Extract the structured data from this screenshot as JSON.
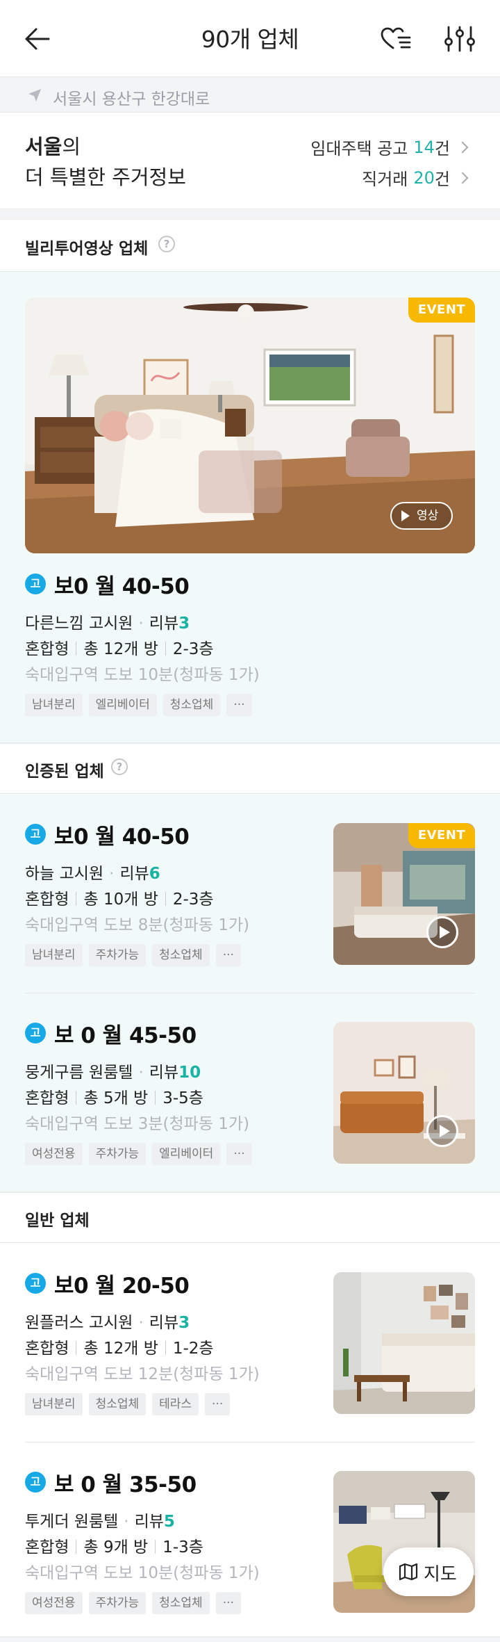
{
  "header": {
    "title": "90개 업체",
    "back_icon": "arrow-left-icon",
    "favorites_icon": "heart-list-icon",
    "filter_icon": "sliders-icon"
  },
  "location": {
    "icon": "navigation-arrow-icon",
    "text": "서울시 용산구 한강대로"
  },
  "summary": {
    "city": "서울",
    "city_suffix": "의",
    "subtitle": "더 특별한 주거정보",
    "rows": [
      {
        "label": "임대주택 공고",
        "count": "14",
        "unit": "건"
      },
      {
        "label": "직거래",
        "count": "20",
        "unit": "건"
      }
    ]
  },
  "sections": {
    "video": {
      "title": "빌리투어영상 업체"
    },
    "verified": {
      "title": "인증된 업체"
    },
    "general": {
      "title": "일반 업체"
    }
  },
  "badges": {
    "event": "EVENT",
    "video_pill": "영상",
    "type_go": "고"
  },
  "colors": {
    "accent_teal": "#18b3a3",
    "badge_blue": "#16a9e6",
    "event_yellow": "#f6b800",
    "mint_bg": "#f1faf9"
  },
  "listings": [
    {
      "price": "보0 월 40-50",
      "name": "다른느낌 고시원",
      "review_label": "리뷰",
      "review_count": "3",
      "room_type": "혼합형",
      "rooms": "총 12개 방",
      "floors": "2-3층",
      "station": "숙대입구역 도보 10분(청파동 1가)",
      "tags": [
        "남녀분리",
        "엘리베이터",
        "청소업체",
        "···"
      ]
    },
    {
      "price": "보0 월 40-50",
      "name": "하늘 고시원",
      "review_label": "리뷰",
      "review_count": "6",
      "room_type": "혼합형",
      "rooms": "총 10개 방",
      "floors": "2-3층",
      "station": "숙대입구역 도보 8분(청파동 1가)",
      "tags": [
        "남녀분리",
        "주차가능",
        "청소업체",
        "···"
      ]
    },
    {
      "price": "보 0 월 45-50",
      "name": "뭉게구름 원룸텔",
      "review_label": "리뷰",
      "review_count": "10",
      "room_type": "혼합형",
      "rooms": "총 5개 방",
      "floors": "3-5층",
      "station": "숙대입구역 도보 3분(청파동 1가)",
      "tags": [
        "여성전용",
        "주차가능",
        "엘리베이터",
        "···"
      ]
    },
    {
      "price": "보0 월 20-50",
      "name": "원플러스 고시원",
      "review_label": "리뷰",
      "review_count": "3",
      "room_type": "혼합형",
      "rooms": "총 12개 방",
      "floors": "1-2층",
      "station": "숙대입구역 도보 12분(청파동 1가)",
      "tags": [
        "남녀분리",
        "청소업체",
        "테라스",
        "···"
      ]
    },
    {
      "price": "보 0 월 35-50",
      "name": "투게더 원룸텔",
      "review_label": "리뷰",
      "review_count": "5",
      "room_type": "혼합형",
      "rooms": "총 9개 방",
      "floors": "1-3층",
      "station": "숙대입구역 도보 10분(청파동 1가)",
      "tags": [
        "여성전용",
        "주차가능",
        "청소업체",
        "···"
      ]
    }
  ],
  "map_button": {
    "label": "지도",
    "icon": "map-icon"
  }
}
